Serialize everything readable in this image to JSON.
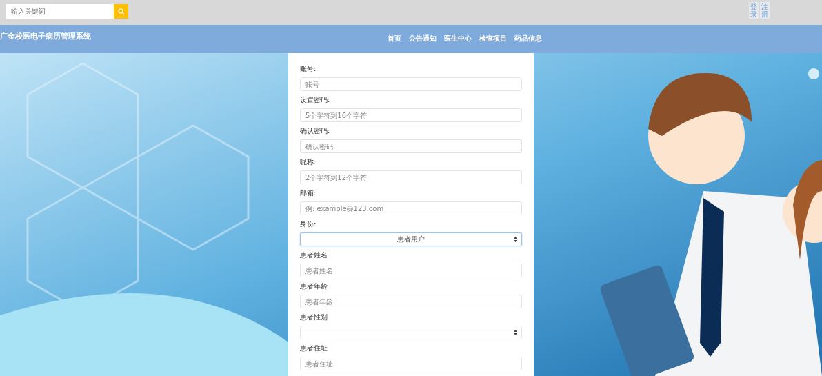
{
  "top_bar": {
    "search": {
      "placeholder": "输入关键词"
    },
    "links": [
      {
        "label": "登录"
      },
      {
        "label": "注册"
      }
    ]
  },
  "nav": {
    "title": "广金校医电子病历管理系统",
    "items": [
      {
        "label": "首页"
      },
      {
        "label": "公告通知"
      },
      {
        "label": "医生中心"
      },
      {
        "label": "检查项目"
      },
      {
        "label": "药品信息"
      }
    ]
  },
  "form": {
    "fields": [
      {
        "kind": "input",
        "label": "账号:",
        "placeholder": "账号"
      },
      {
        "kind": "input",
        "label": "设置密码:",
        "placeholder": "5个字符到16个字符"
      },
      {
        "kind": "input",
        "label": "确认密码:",
        "placeholder": "确认密码"
      },
      {
        "kind": "input",
        "label": "昵称:",
        "placeholder": "2个字符到12个字符"
      },
      {
        "kind": "input",
        "label": "邮箱:",
        "placeholder": "例: example@123.com"
      },
      {
        "kind": "select",
        "label": "身份:",
        "value": "患者用户",
        "focused": true
      },
      {
        "kind": "input",
        "label": "患者姓名",
        "placeholder": "患者姓名"
      },
      {
        "kind": "input",
        "label": "患者年龄",
        "placeholder": "患者年龄"
      },
      {
        "kind": "select",
        "label": "患者性别",
        "focused": false
      },
      {
        "kind": "input",
        "label": "患者住址",
        "placeholder": "患者住址"
      }
    ]
  }
}
